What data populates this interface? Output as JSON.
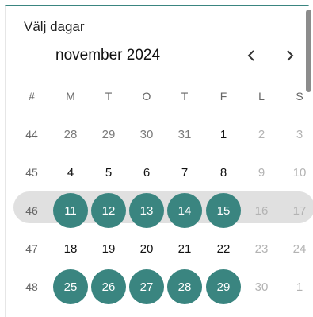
{
  "title": "Välj dagar",
  "month_label": "november 2024",
  "colors": {
    "accent": "#3a8580",
    "band": "#e0e0e0"
  },
  "nav": {
    "prev_icon": "chevron-left-icon",
    "next_icon": "chevron-right-icon"
  },
  "headers": [
    "#",
    "M",
    "T",
    "O",
    "T",
    "F",
    "L",
    "S"
  ],
  "weeks": [
    {
      "week": "44",
      "days": [
        "28",
        "29",
        "30",
        "31",
        "1",
        "2",
        "3"
      ]
    },
    {
      "week": "45",
      "days": [
        "4",
        "5",
        "6",
        "7",
        "8",
        "9",
        "10"
      ]
    },
    {
      "week": "46",
      "days": [
        "11",
        "12",
        "13",
        "14",
        "15",
        "16",
        "17"
      ]
    },
    {
      "week": "47",
      "days": [
        "18",
        "19",
        "20",
        "21",
        "22",
        "23",
        "24"
      ]
    },
    {
      "week": "48",
      "days": [
        "25",
        "26",
        "27",
        "28",
        "29",
        "30",
        "1"
      ]
    }
  ],
  "selected_days": [
    "11",
    "12",
    "13",
    "14",
    "15",
    "25",
    "26",
    "27",
    "28",
    "29"
  ],
  "highlighted_week": "46"
}
